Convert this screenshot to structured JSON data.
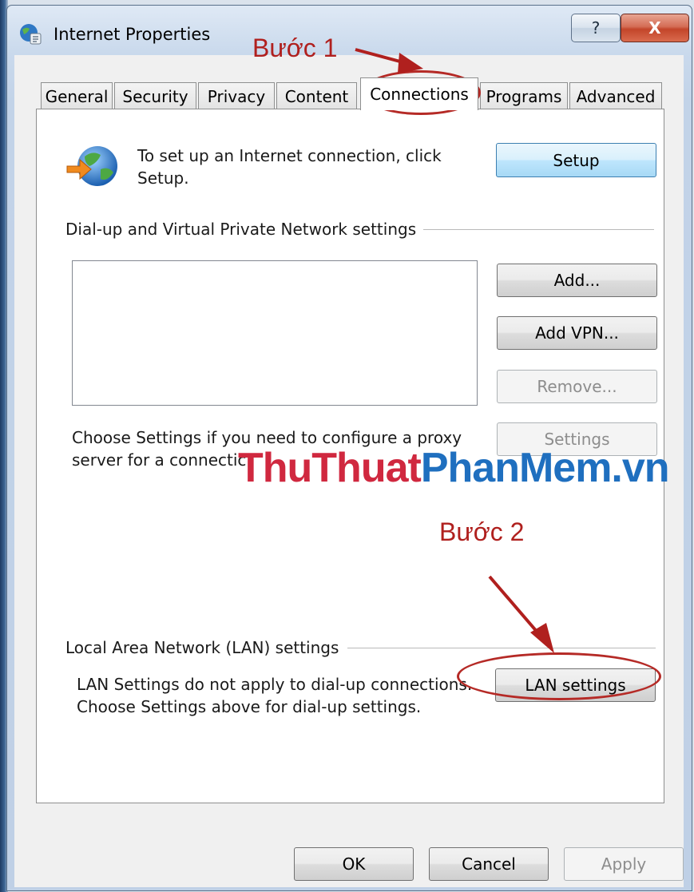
{
  "window": {
    "title": "Internet Properties",
    "help_glyph": "?",
    "close_glyph": "X"
  },
  "tabs": [
    {
      "label": "General",
      "active": false
    },
    {
      "label": "Security",
      "active": false
    },
    {
      "label": "Privacy",
      "active": false
    },
    {
      "label": "Content",
      "active": false
    },
    {
      "label": "Connections",
      "active": true
    },
    {
      "label": "Programs",
      "active": false
    },
    {
      "label": "Advanced",
      "active": false
    }
  ],
  "setup": {
    "description": "To set up an Internet connection, click Setup.",
    "button": "Setup",
    "icon": "globe-arrow-icon"
  },
  "dialup": {
    "group_title": "Dial-up and Virtual Private Network settings",
    "add_button": "Add...",
    "add_vpn_button": "Add VPN...",
    "remove_button": "Remove...",
    "settings_button": "Settings",
    "proxy_text": "Choose Settings if you need to configure a proxy server for a connectic"
  },
  "lan": {
    "group_title": "Local Area Network (LAN) settings",
    "description": "LAN Settings do not apply to dial-up connections. Choose Settings above for dial-up settings.",
    "button": "LAN settings"
  },
  "footer": {
    "ok": "OK",
    "cancel": "Cancel",
    "apply": "Apply"
  },
  "annotations": {
    "step1": "Bước 1",
    "step2": "Bước 2",
    "watermark_part1": "ThuThuat",
    "watermark_part2": "PhanMem.vn",
    "color": "#b0201e"
  },
  "colors": {
    "watermark_red": "#d0283f",
    "watermark_blue": "#1f6fbf",
    "close_button": "#c3452a"
  }
}
